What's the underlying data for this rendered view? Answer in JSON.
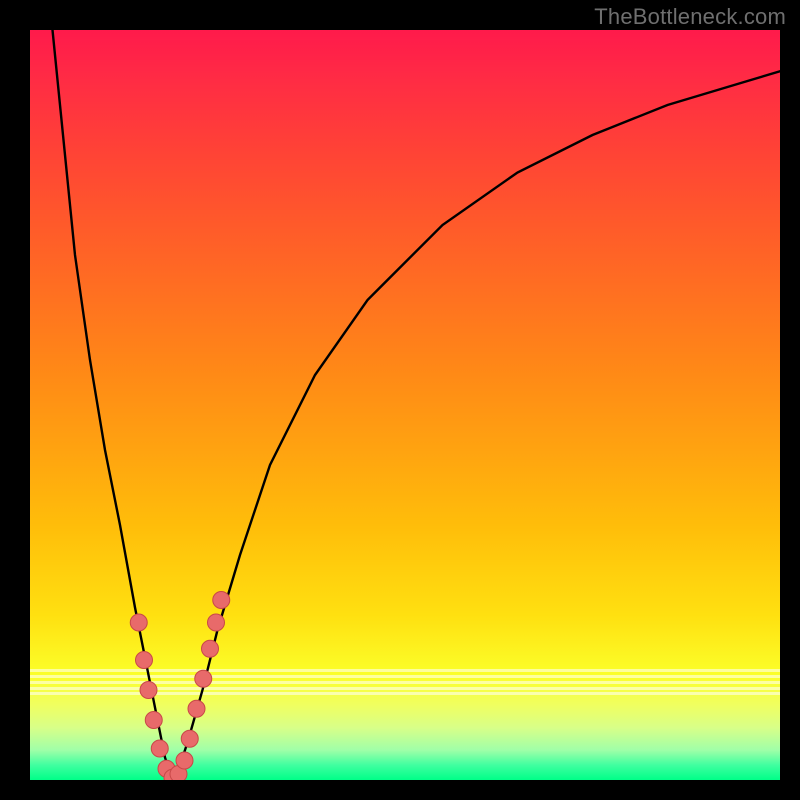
{
  "attribution": "TheBottleneck.com",
  "colors": {
    "frame": "#000000",
    "curve": "#000000",
    "marker_fill": "#e86a6a",
    "marker_stroke": "#c84848"
  },
  "chart_data": {
    "type": "line",
    "title": "",
    "xlabel": "",
    "ylabel": "",
    "xlim": [
      0,
      100
    ],
    "ylim": [
      0,
      100
    ],
    "x": [
      3,
      4,
      5,
      6,
      8,
      10,
      12,
      14,
      15,
      16,
      17,
      18,
      19,
      20,
      21,
      23,
      25,
      28,
      32,
      38,
      45,
      55,
      65,
      75,
      85,
      95,
      100
    ],
    "values": [
      100,
      90,
      80,
      70,
      56,
      44,
      34,
      23,
      18,
      13,
      8,
      3,
      0,
      2,
      5,
      12,
      20,
      30,
      42,
      54,
      64,
      74,
      81,
      86,
      90,
      93,
      94.5
    ],
    "series": [
      {
        "name": "bottleneck-curve",
        "x": [
          3,
          4,
          5,
          6,
          8,
          10,
          12,
          14,
          15,
          16,
          17,
          18,
          19,
          20,
          21,
          23,
          25,
          28,
          32,
          38,
          45,
          55,
          65,
          75,
          85,
          95,
          100
        ],
        "y": [
          100,
          90,
          80,
          70,
          56,
          44,
          34,
          23,
          18,
          13,
          8,
          3,
          0,
          2,
          5,
          12,
          20,
          30,
          42,
          54,
          64,
          74,
          81,
          86,
          90,
          93,
          94.5
        ]
      }
    ],
    "markers": [
      {
        "x": 14.5,
        "y": 21
      },
      {
        "x": 15.2,
        "y": 16
      },
      {
        "x": 15.8,
        "y": 12
      },
      {
        "x": 16.5,
        "y": 8
      },
      {
        "x": 17.3,
        "y": 4.2
      },
      {
        "x": 18.2,
        "y": 1.5
      },
      {
        "x": 19.0,
        "y": 0.3
      },
      {
        "x": 19.8,
        "y": 0.8
      },
      {
        "x": 20.6,
        "y": 2.6
      },
      {
        "x": 21.3,
        "y": 5.5
      },
      {
        "x": 22.2,
        "y": 9.5
      },
      {
        "x": 23.1,
        "y": 13.5
      },
      {
        "x": 24.0,
        "y": 17.5
      },
      {
        "x": 24.8,
        "y": 21
      },
      {
        "x": 25.5,
        "y": 24
      }
    ],
    "white_bands_y": [
      85.2,
      86.0,
      86.8,
      87.6,
      88.3
    ]
  }
}
